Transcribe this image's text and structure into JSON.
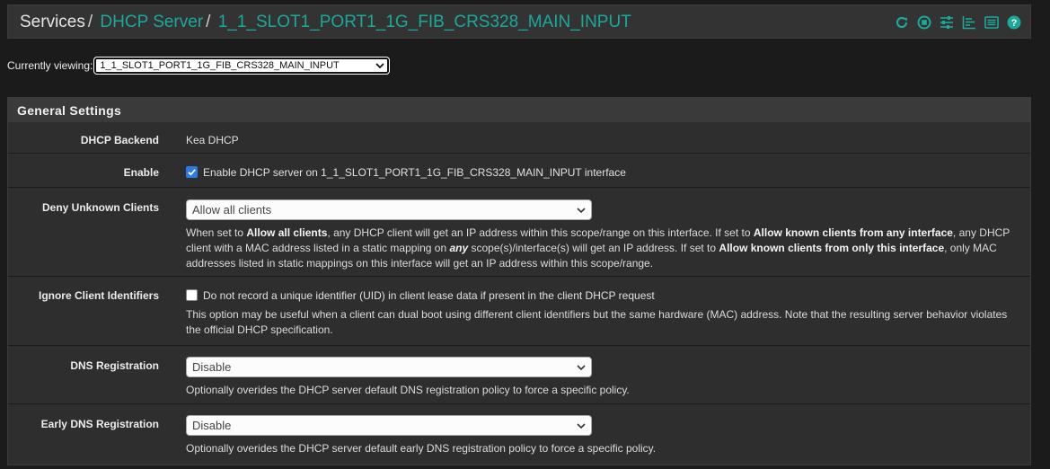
{
  "breadcrumb": {
    "root": "Services",
    "sep": "/",
    "section": "DHCP Server",
    "page": "1_1_SLOT1_PORT1_1G_FIB_CRS328_MAIN_INPUT"
  },
  "header_icons": [
    "reload-icon",
    "stop-icon",
    "sliders-icon",
    "bar-chart-icon",
    "log-list-icon",
    "help-icon"
  ],
  "viewing": {
    "label": "Currently viewing:",
    "value": "1_1_SLOT1_PORT1_1G_FIB_CRS328_MAIN_INPUT"
  },
  "panel": {
    "title": "General Settings"
  },
  "rows": {
    "backend": {
      "label": "DHCP Backend",
      "value": "Kea DHCP"
    },
    "enable": {
      "label": "Enable",
      "checked": true,
      "text": "Enable DHCP server on 1_1_SLOT1_PORT1_1G_FIB_CRS328_MAIN_INPUT interface"
    },
    "deny": {
      "label": "Deny Unknown Clients",
      "select": "Allow all clients",
      "help": {
        "p1": "When set to ",
        "b1": "Allow all clients",
        "p2": ", any DHCP client will get an IP address within this scope/range on this interface. If set to ",
        "b2": "Allow known clients from any interface",
        "p3": ", any DHCP client with a MAC address listed in a static mapping on ",
        "i1": "any",
        "p4": " scope(s)/interface(s) will get an IP address. If set to ",
        "b3": "Allow known clients from only this interface",
        "p5": ", only MAC addresses listed in static mappings on this interface will get an IP address within this scope/range."
      }
    },
    "ignore": {
      "label": "Ignore Client Identifiers",
      "checked": false,
      "text": "Do not record a unique identifier (UID) in client lease data if present in the client DHCP request",
      "help": "This option may be useful when a client can dual boot using different client identifiers but the same hardware (MAC) address. Note that the resulting server behavior violates the official DHCP specification."
    },
    "dns": {
      "label": "DNS Registration",
      "select": "Disable",
      "help": "Optionally overides the DHCP server default DNS registration policy to force a specific policy."
    },
    "early_dns": {
      "label": "Early DNS Registration",
      "select": "Disable",
      "help": "Optionally overides the DHCP server default early DNS registration policy to force a specific policy."
    }
  },
  "colors": {
    "accent": "#1aa99a",
    "checkbox_on": "#2a7be4",
    "background": "#1b1b1b",
    "panel": "#2e2e2e"
  }
}
